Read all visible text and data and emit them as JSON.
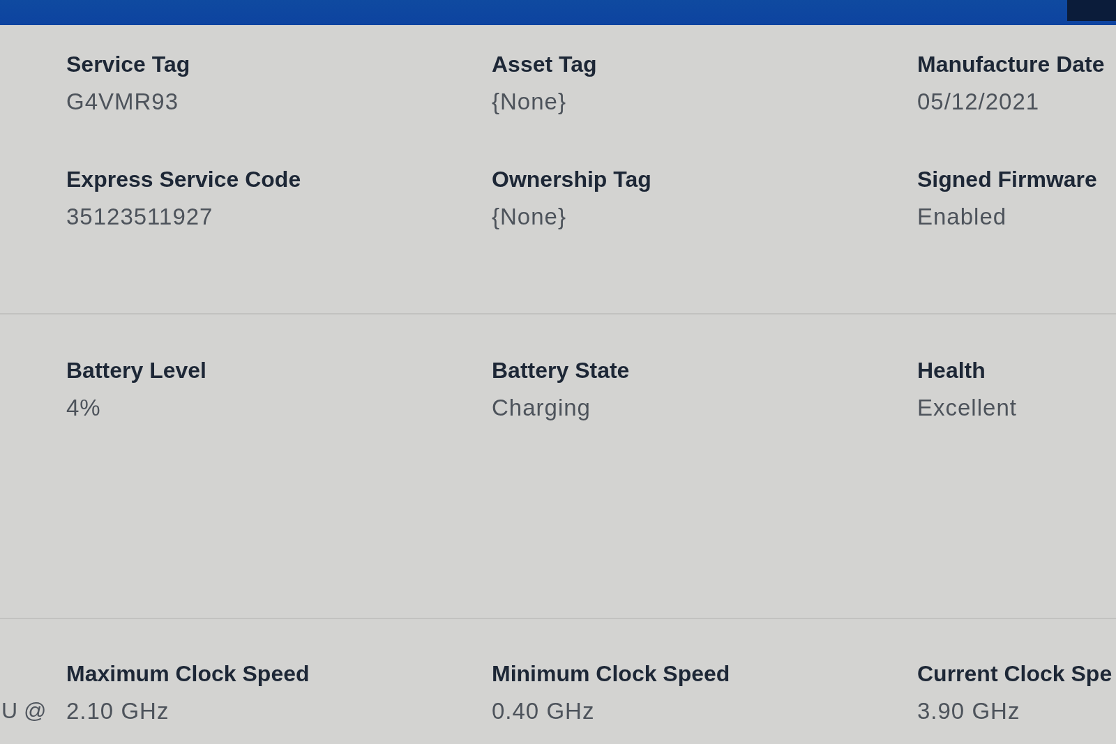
{
  "sections": [
    {
      "fields": [
        {
          "label": "Service Tag",
          "value": "G4VMR93"
        },
        {
          "label": "Asset Tag",
          "value": "{None}"
        },
        {
          "label": "Manufacture Date",
          "value": "05/12/2021"
        },
        {
          "label": "Express Service Code",
          "value": "35123511927"
        },
        {
          "label": "Ownership Tag",
          "value": "{None}"
        },
        {
          "label": "Signed Firmware",
          "value": "Enabled"
        }
      ]
    },
    {
      "fields": [
        {
          "label": "Battery Level",
          "value": "4%"
        },
        {
          "label": "Battery State",
          "value": "Charging"
        },
        {
          "label": "Health",
          "value": "Excellent"
        }
      ]
    },
    {
      "left_fragment": "U @",
      "fields": [
        {
          "label": "Maximum Clock Speed",
          "value": "2.10 GHz"
        },
        {
          "label": "Minimum Clock Speed",
          "value": "0.40 GHz"
        },
        {
          "label": "Current Clock Spe",
          "value": "3.90 GHz"
        }
      ]
    }
  ]
}
